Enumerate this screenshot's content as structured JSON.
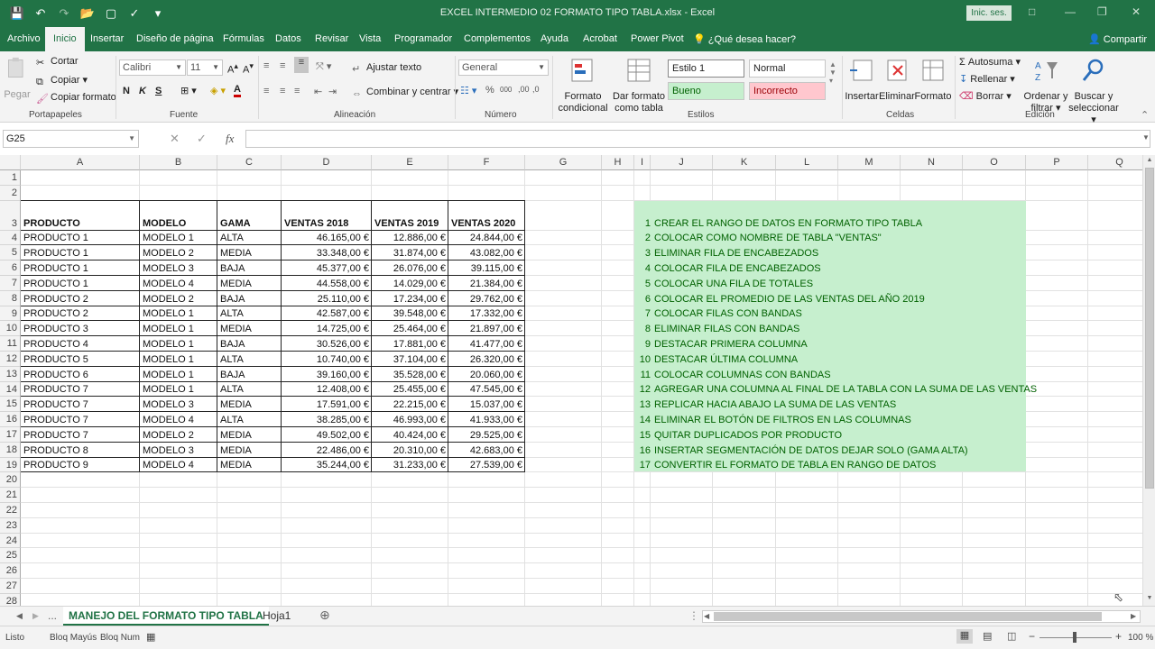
{
  "window": {
    "title": "EXCEL INTERMEDIO 02 FORMATO TIPO TABLA.xlsx  -  Excel",
    "signin": "Inic. ses."
  },
  "menu": {
    "tabs": [
      "Archivo",
      "Inicio",
      "Insertar",
      "Diseño de página",
      "Fórmulas",
      "Datos",
      "Revisar",
      "Vista",
      "Programador",
      "Complementos",
      "Ayuda",
      "Acrobat",
      "Power Pivot"
    ],
    "active_tab": "Inicio",
    "tell_me": "¿Qué desea hacer?",
    "share": "Compartir"
  },
  "ribbon": {
    "clipboard": {
      "paste": "Pegar",
      "cut": "Cortar",
      "copy": "Copiar",
      "format_painter": "Copiar formato",
      "label": "Portapapeles"
    },
    "font": {
      "name": "Calibri",
      "size": "11",
      "bold": "N",
      "italic": "K",
      "underline": "S",
      "label": "Fuente"
    },
    "alignment": {
      "wrap": "Ajustar texto",
      "merge": "Combinar y centrar",
      "label": "Alineación"
    },
    "number": {
      "format": "General",
      "label": "Número"
    },
    "styles": {
      "cond_format_1": "Formato",
      "cond_format_2": "condicional",
      "as_table_1": "Dar formato",
      "as_table_2": "como tabla",
      "estilo1": "Estilo 1",
      "normal": "Normal",
      "bueno": "Bueno",
      "incorrecto": "Incorrecto",
      "label": "Estilos"
    },
    "cells": {
      "insert": "Insertar",
      "delete": "Eliminar",
      "format": "Formato",
      "label": "Celdas"
    },
    "editing": {
      "autosum": "Autosuma",
      "fill": "Rellenar",
      "clear": "Borrar",
      "sort_1": "Ordenar y",
      "sort_2": "filtrar",
      "find_1": "Buscar y",
      "find_2": "seleccionar",
      "label": "Edición"
    }
  },
  "formula_bar": {
    "name_box": "G25",
    "fx": "fx",
    "value": ""
  },
  "columns": [
    "A",
    "B",
    "C",
    "D",
    "E",
    "F",
    "G",
    "H",
    "I",
    "J",
    "K",
    "L",
    "M",
    "N",
    "O",
    "P",
    "Q"
  ],
  "rows": [
    "1",
    "2",
    "3",
    "4",
    "5",
    "6",
    "7",
    "8",
    "9",
    "10",
    "11",
    "12",
    "13",
    "14",
    "15",
    "16",
    "17",
    "18",
    "19",
    "20",
    "21",
    "22",
    "23",
    "24",
    "25",
    "26",
    "27",
    "28"
  ],
  "table": {
    "headers": [
      "PRODUCTO",
      "MODELO",
      "GAMA",
      "VENTAS 2018",
      "VENTAS 2019",
      "VENTAS 2020"
    ],
    "rows": [
      [
        "PRODUCTO 1",
        "MODELO 1",
        "ALTA",
        "46.165,00 €",
        "12.886,00 €",
        "24.844,00 €"
      ],
      [
        "PRODUCTO 1",
        "MODELO 2",
        "MEDIA",
        "33.348,00 €",
        "31.874,00 €",
        "43.082,00 €"
      ],
      [
        "PRODUCTO 1",
        "MODELO 3",
        "BAJA",
        "45.377,00 €",
        "26.076,00 €",
        "39.115,00 €"
      ],
      [
        "PRODUCTO 1",
        "MODELO 4",
        "MEDIA",
        "44.558,00 €",
        "14.029,00 €",
        "21.384,00 €"
      ],
      [
        "PRODUCTO 2",
        "MODELO 2",
        "BAJA",
        "25.110,00 €",
        "17.234,00 €",
        "29.762,00 €"
      ],
      [
        "PRODUCTO 2",
        "MODELO 1",
        "ALTA",
        "42.587,00 €",
        "39.548,00 €",
        "17.332,00 €"
      ],
      [
        "PRODUCTO 3",
        "MODELO 1",
        "MEDIA",
        "14.725,00 €",
        "25.464,00 €",
        "21.897,00 €"
      ],
      [
        "PRODUCTO 4",
        "MODELO 1",
        "BAJA",
        "30.526,00 €",
        "17.881,00 €",
        "41.477,00 €"
      ],
      [
        "PRODUCTO 5",
        "MODELO 1",
        "ALTA",
        "10.740,00 €",
        "37.104,00 €",
        "26.320,00 €"
      ],
      [
        "PRODUCTO 6",
        "MODELO 1",
        "BAJA",
        "39.160,00 €",
        "35.528,00 €",
        "20.060,00 €"
      ],
      [
        "PRODUCTO 7",
        "MODELO 1",
        "ALTA",
        "12.408,00 €",
        "25.455,00 €",
        "47.545,00 €"
      ],
      [
        "PRODUCTO 7",
        "MODELO 3",
        "MEDIA",
        "17.591,00 €",
        "22.215,00 €",
        "15.037,00 €"
      ],
      [
        "PRODUCTO 7",
        "MODELO 4",
        "ALTA",
        "38.285,00 €",
        "46.993,00 €",
        "41.933,00 €"
      ],
      [
        "PRODUCTO 7",
        "MODELO 2",
        "MEDIA",
        "49.502,00 €",
        "40.424,00 €",
        "29.525,00 €"
      ],
      [
        "PRODUCTO 8",
        "MODELO 3",
        "MEDIA",
        "22.486,00 €",
        "20.310,00 €",
        "42.683,00 €"
      ],
      [
        "PRODUCTO 9",
        "MODELO 4",
        "MEDIA",
        "35.244,00 €",
        "31.233,00 €",
        "27.539,00 €"
      ]
    ]
  },
  "tasks": [
    {
      "n": "1",
      "text": "CREAR EL RANGO DE DATOS EN FORMATO TIPO TABLA"
    },
    {
      "n": "2",
      "text": "COLOCAR COMO NOMBRE DE TABLA \"VENTAS\""
    },
    {
      "n": "3",
      "text": "ELIMINAR FILA DE ENCABEZADOS"
    },
    {
      "n": "4",
      "text": "COLOCAR FILA DE ENCABEZADOS"
    },
    {
      "n": "5",
      "text": "COLOCAR UNA FILA DE TOTALES"
    },
    {
      "n": "6",
      "text": "COLOCAR EL PROMEDIO DE LAS VENTAS DEL AÑO 2019"
    },
    {
      "n": "7",
      "text": "COLOCAR FILAS CON BANDAS"
    },
    {
      "n": "8",
      "text": "ELIMINAR FILAS CON BANDAS"
    },
    {
      "n": "9",
      "text": "DESTACAR PRIMERA COLUMNA"
    },
    {
      "n": "10",
      "text": "DESTACAR ÚLTIMA COLUMNA"
    },
    {
      "n": "11",
      "text": "COLOCAR COLUMNAS CON BANDAS"
    },
    {
      "n": "12",
      "text": "AGREGAR UNA COLUMNA AL FINAL DE LA TABLA CON LA SUMA DE LAS VENTAS"
    },
    {
      "n": "13",
      "text": "REPLICAR HACIA ABAJO LA SUMA DE LAS VENTAS"
    },
    {
      "n": "14",
      "text": "ELIMINAR EL BOTÓN DE FILTROS EN LAS COLUMNAS"
    },
    {
      "n": "15",
      "text": "QUITAR DUPLICADOS POR PRODUCTO"
    },
    {
      "n": "16",
      "text": "INSERTAR SEGMENTACIÓN DE DATOS DEJAR SOLO (GAMA ALTA)"
    },
    {
      "n": "17",
      "text": "CONVERTIR EL FORMATO DE TABLA EN RANGO DE DATOS"
    }
  ],
  "sheet_tabs": {
    "ellipsis": "...",
    "active": "MANEJO DEL FORMATO TIPO TABLA",
    "other": "Hoja1"
  },
  "status": {
    "ready": "Listo",
    "caps": "Bloq Mayús",
    "num": "Bloq Num",
    "zoom": "100 %"
  },
  "colors": {
    "brand": "#217346",
    "task_bg": "#c6efce",
    "task_text": "#006100",
    "bad_bg": "#ffc7ce",
    "bad_text": "#9c0006"
  }
}
